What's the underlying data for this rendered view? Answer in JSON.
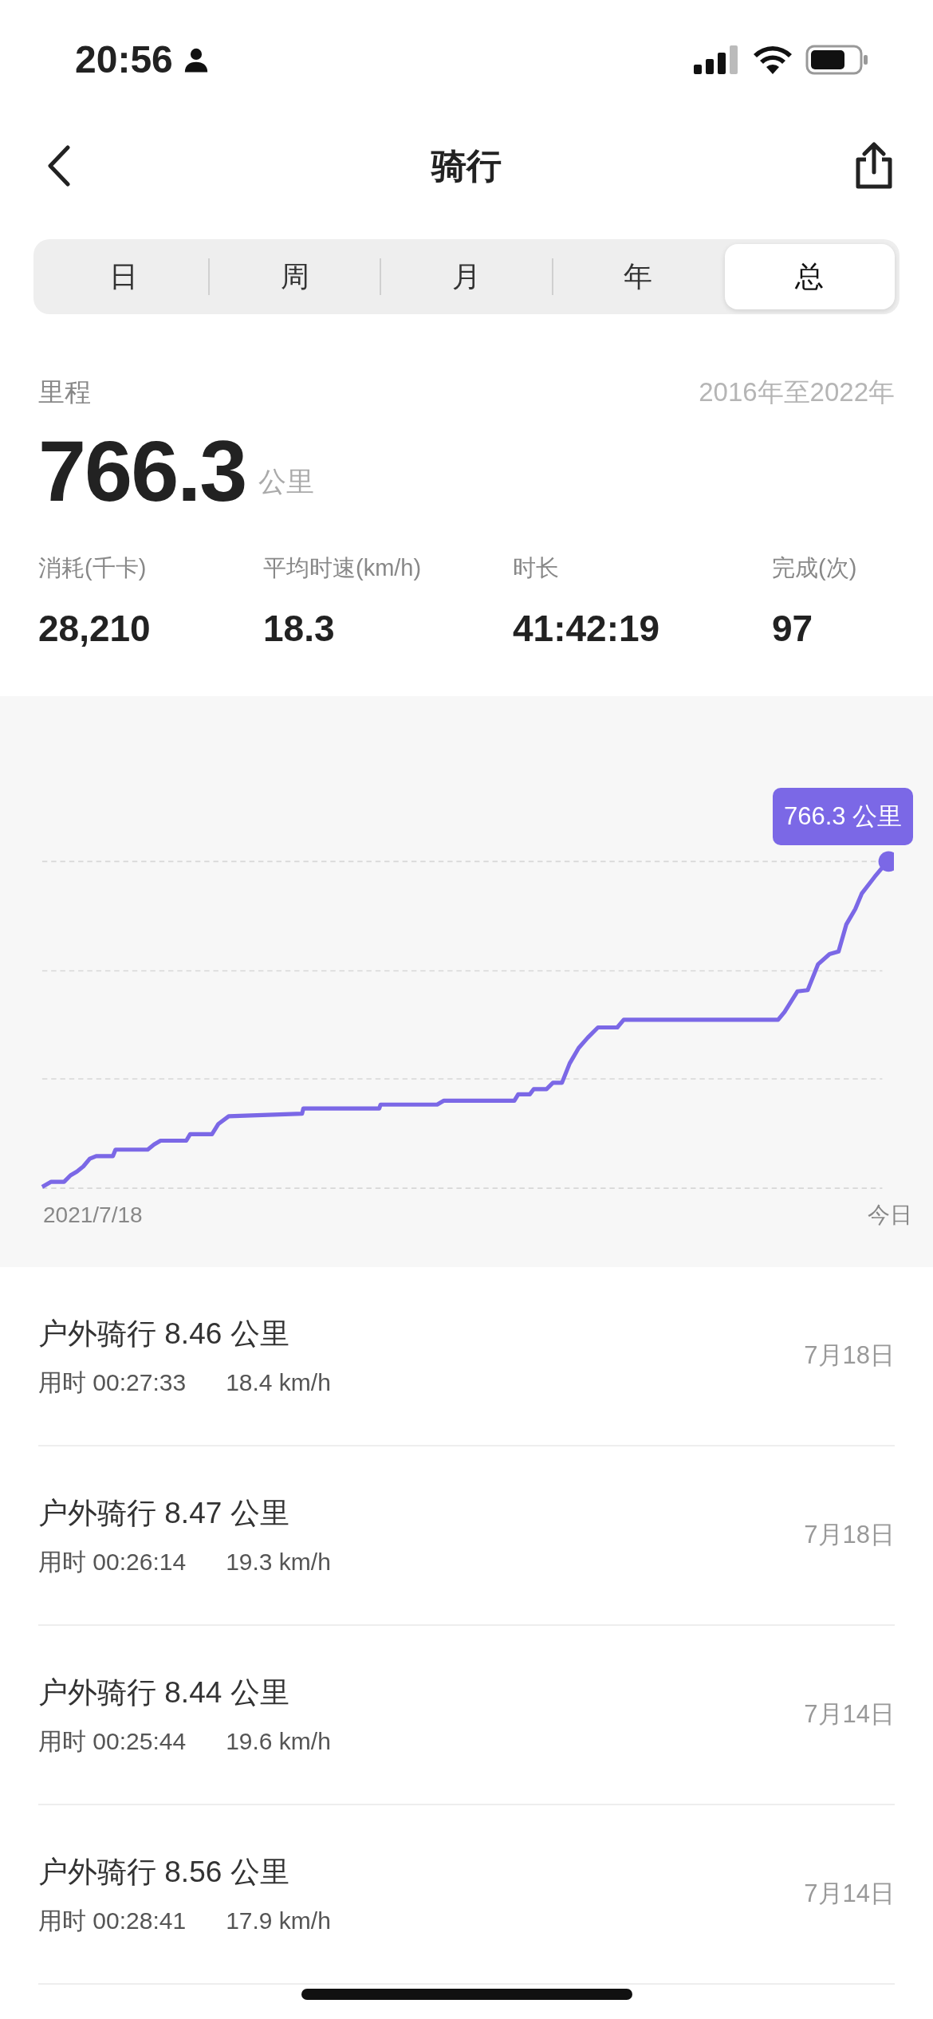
{
  "status_bar": {
    "time": "20:56"
  },
  "nav": {
    "title": "骑行"
  },
  "tabs": [
    {
      "label": "日",
      "selected": false
    },
    {
      "label": "周",
      "selected": false
    },
    {
      "label": "月",
      "selected": false
    },
    {
      "label": "年",
      "selected": false
    },
    {
      "label": "总",
      "selected": true
    }
  ],
  "summary": {
    "label": "里程",
    "range": "2016年至2022年",
    "value": "766.3",
    "unit": "公里"
  },
  "stats": [
    {
      "label": "消耗(千卡)",
      "value": "28,210"
    },
    {
      "label": "平均时速(km/h)",
      "value": "18.3"
    },
    {
      "label": "时长",
      "value": "41:42:19"
    },
    {
      "label": "完成(次)",
      "value": "97"
    }
  ],
  "chart": {
    "tooltip": "766.3 公里",
    "x_start": "2021/7/18",
    "x_end": "今日"
  },
  "activities": [
    {
      "title": "户外骑行 8.46 公里",
      "duration": "用时 00:27:33",
      "speed": "18.4 km/h",
      "date": "7月18日"
    },
    {
      "title": "户外骑行 8.47 公里",
      "duration": "用时 00:26:14",
      "speed": "19.3 km/h",
      "date": "7月18日"
    },
    {
      "title": "户外骑行 8.44 公里",
      "duration": "用时 00:25:44",
      "speed": "19.6 km/h",
      "date": "7月14日"
    },
    {
      "title": "户外骑行 8.56 公里",
      "duration": "用时 00:28:41",
      "speed": "17.9 km/h",
      "date": "7月14日"
    }
  ]
}
